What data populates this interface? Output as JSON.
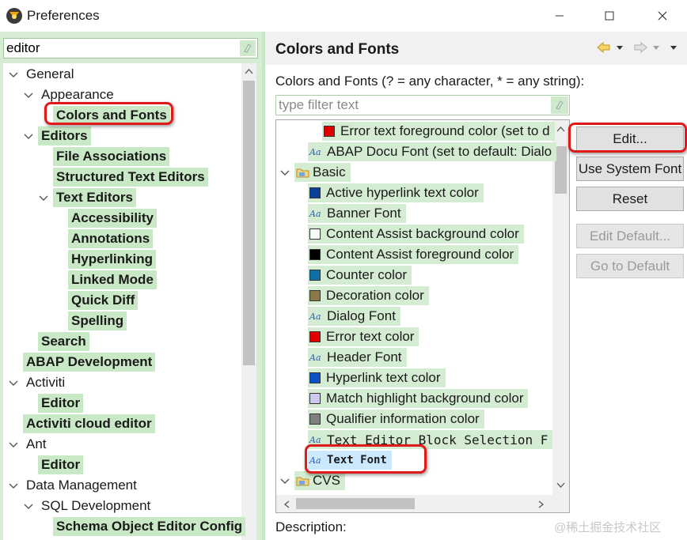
{
  "window": {
    "title": "Preferences",
    "minimize_icon": "minimize-icon",
    "maximize_icon": "maximize-icon",
    "close_icon": "close-icon"
  },
  "left": {
    "search_value": "editor",
    "tree": [
      {
        "label": "General",
        "level": 0,
        "expanded": true,
        "bold": false
      },
      {
        "label": "Appearance",
        "level": 1,
        "expanded": true,
        "bold": false
      },
      {
        "label": "Colors and Fonts",
        "level": 2,
        "bold": true,
        "selected": true
      },
      {
        "label": "Editors",
        "level": 1,
        "expanded": true,
        "bold": true
      },
      {
        "label": "File Associations",
        "level": 2,
        "bold": true
      },
      {
        "label": "Structured Text Editors",
        "level": 2,
        "bold": true
      },
      {
        "label": "Text Editors",
        "level": 2,
        "expanded": true,
        "bold": true
      },
      {
        "label": "Accessibility",
        "level": 3,
        "bold": true
      },
      {
        "label": "Annotations",
        "level": 3,
        "bold": true
      },
      {
        "label": "Hyperlinking",
        "level": 3,
        "bold": true
      },
      {
        "label": "Linked Mode",
        "level": 3,
        "bold": true
      },
      {
        "label": "Quick Diff",
        "level": 3,
        "bold": true
      },
      {
        "label": "Spelling",
        "level": 3,
        "bold": true
      },
      {
        "label": "Search",
        "level": 1,
        "bold": true
      },
      {
        "label": "ABAP Development",
        "level": 0,
        "bold": true
      },
      {
        "label": "Activiti",
        "level": 0,
        "expanded": true,
        "bold": false
      },
      {
        "label": "Editor",
        "level": 1,
        "bold": true
      },
      {
        "label": "Activiti cloud editor",
        "level": 0,
        "bold": true
      },
      {
        "label": "Ant",
        "level": 0,
        "expanded": true,
        "bold": false
      },
      {
        "label": "Editor",
        "level": 1,
        "bold": true
      },
      {
        "label": "Data Management",
        "level": 0,
        "expanded": true,
        "bold": false
      },
      {
        "label": "SQL Development",
        "level": 1,
        "expanded": true,
        "bold": false
      },
      {
        "label": "Schema Object Editor Config",
        "level": 2,
        "bold": true
      }
    ]
  },
  "right": {
    "title": "Colors and Fonts",
    "colors_label": "Colors and Fonts (? = any character, * = any string):",
    "filter_placeholder": "type filter text",
    "description_label": "Description:",
    "items": [
      {
        "kind": "color",
        "label": "Error text foreground color (set to d",
        "color": "#e00000",
        "level": 2
      },
      {
        "kind": "font",
        "label": "ABAP Docu Font (set to default: Dialo",
        "level": 1
      },
      {
        "kind": "folder",
        "label": "Basic",
        "level": 0
      },
      {
        "kind": "color",
        "label": "Active hyperlink text color",
        "color": "#0a3f9a",
        "level": 1
      },
      {
        "kind": "font",
        "label": "Banner Font",
        "level": 1
      },
      {
        "kind": "color",
        "label": "Content Assist background color",
        "color": "#f6fcf6",
        "level": 1
      },
      {
        "kind": "color",
        "label": "Content Assist foreground color",
        "color": "#000000",
        "level": 1
      },
      {
        "kind": "color",
        "label": "Counter color",
        "color": "#0f6fa8",
        "level": 1
      },
      {
        "kind": "color",
        "label": "Decoration color",
        "color": "#8a7a4a",
        "level": 1
      },
      {
        "kind": "font",
        "label": "Dialog Font",
        "level": 1
      },
      {
        "kind": "color",
        "label": "Error text color",
        "color": "#e00000",
        "level": 1
      },
      {
        "kind": "font",
        "label": "Header Font",
        "level": 1
      },
      {
        "kind": "color",
        "label": "Hyperlink text color",
        "color": "#0a52c8",
        "level": 1
      },
      {
        "kind": "color",
        "label": "Match highlight background color",
        "color": "#cfc9f0",
        "level": 1
      },
      {
        "kind": "color",
        "label": "Qualifier information color",
        "color": "#808080",
        "level": 1
      },
      {
        "kind": "font",
        "label": "Text Editor Block Selection F",
        "level": 1,
        "style": "mono"
      },
      {
        "kind": "font",
        "label": "Text Font",
        "level": 1,
        "style": "bold-mono",
        "selected": true
      },
      {
        "kind": "folder",
        "label": "CVS",
        "level": 0
      }
    ],
    "buttons": {
      "edit": "Edit...",
      "use_system_font": "Use System Font",
      "reset": "Reset",
      "edit_default": "Edit Default...",
      "go_to_default": "Go to Default"
    }
  },
  "watermark": "@稀土掘金技术社区",
  "colors": {
    "highlight": "#c9e8c5",
    "pane_bg": "#d6edd4",
    "callout": "#e01a1a"
  }
}
